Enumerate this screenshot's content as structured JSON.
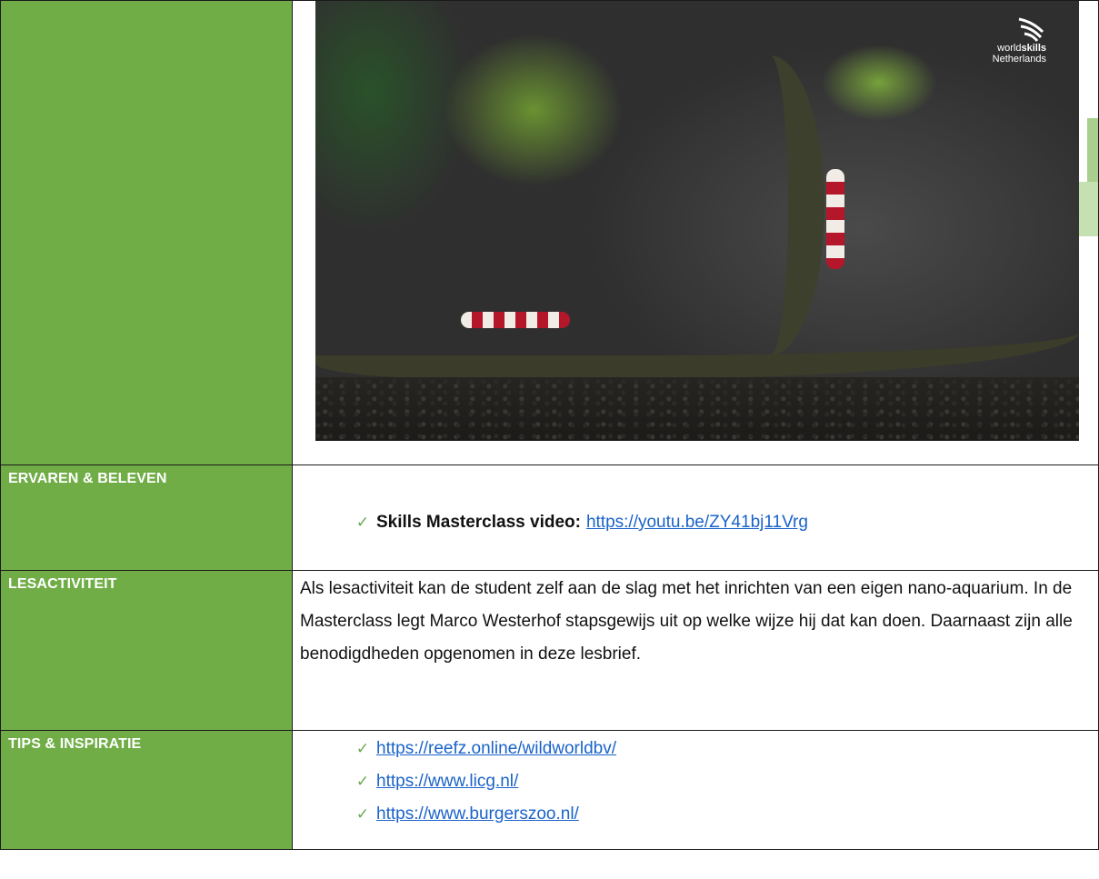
{
  "photo": {
    "logo_text_line1_a": "world",
    "logo_text_line1_b": "skills",
    "logo_text_line2": "Netherlands",
    "logo_icon": "worldskills-swirl-logo"
  },
  "rows": {
    "ervaren": {
      "label": "ERVAREN & BELEVEN",
      "bullet_bold": "Skills Masterclass video:",
      "link": "https://youtu.be/ZY41bj11Vrg"
    },
    "lesactiviteit": {
      "label": "LESACTIVITEIT",
      "text": "Als lesactiviteit kan de student zelf aan de slag met het inrichten van een eigen nano-aquarium. In de Masterclass legt Marco Westerhof stapsgewijs uit op welke wijze hij dat kan doen. Daarnaast zijn alle benodigdheden opgenomen in deze lesbrief."
    },
    "tips": {
      "label": "TIPS & INSPIRATIE",
      "links": [
        "https://reefz.online/wildworldbv/",
        "https://www.licg.nl/",
        "https://www.burgerszoo.nl/"
      ]
    }
  },
  "check_icon": "checkmark-icon",
  "colors": {
    "label_green": "#70ad47",
    "link_blue": "#1a63c9",
    "check_green": "#6aa84f"
  }
}
